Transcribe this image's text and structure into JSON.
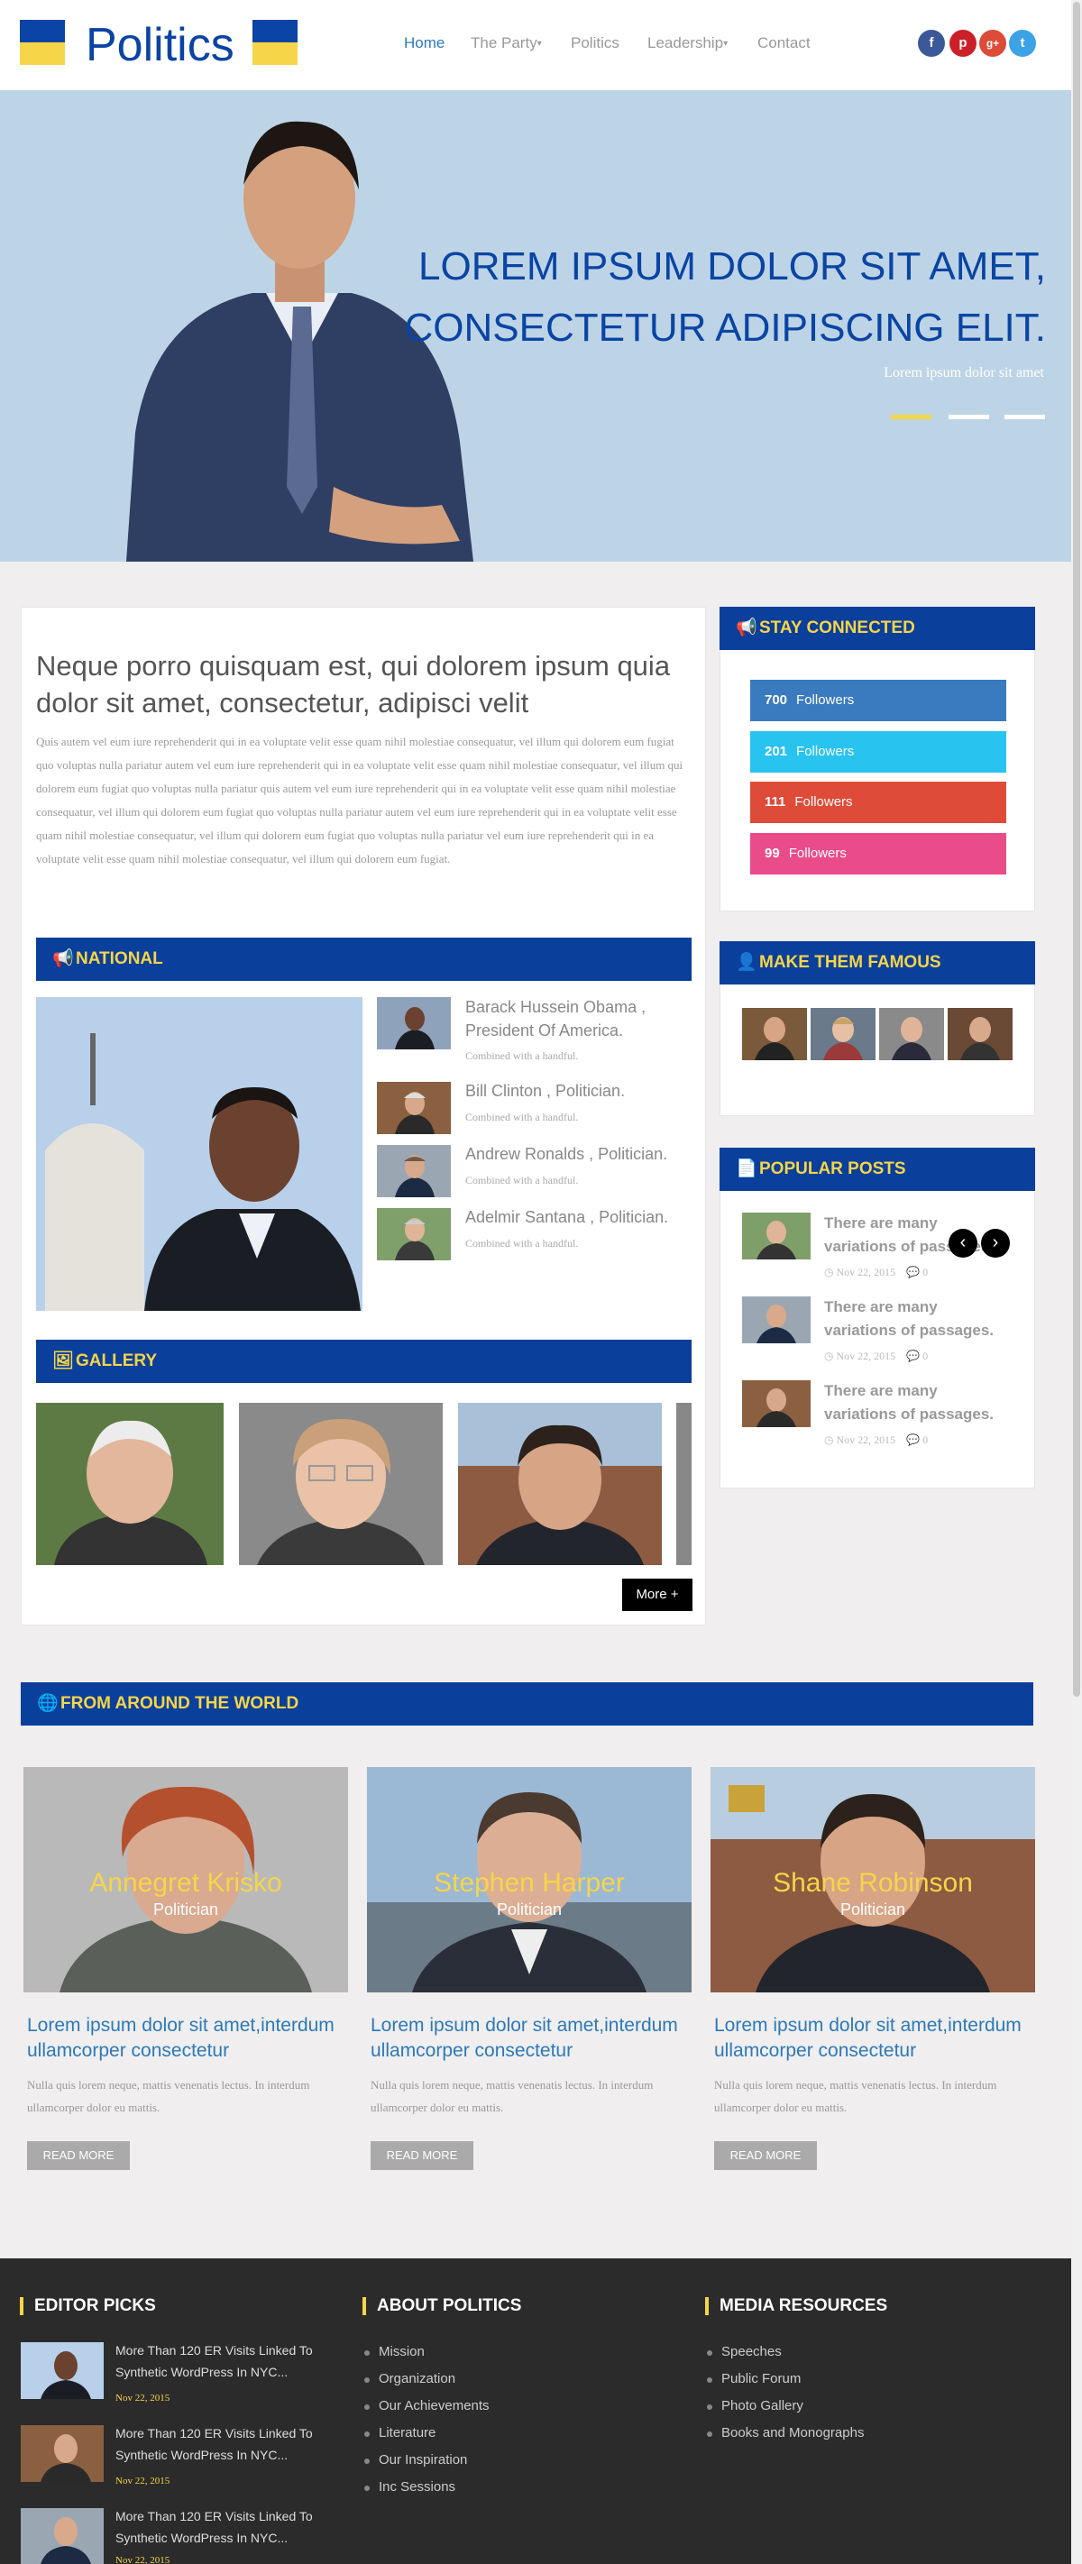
{
  "header": {
    "logo": "Politics",
    "nav": [
      "Home",
      "The Party",
      "Politics",
      "Leadership",
      "Contact"
    ],
    "social": [
      "f",
      "p",
      "g+",
      "t"
    ]
  },
  "hero": {
    "title_line1": "LOREM IPSUM DOLOR SIT AMET,",
    "title_line2": "CONSECTETUR ADIPISCING ELIT.",
    "subtitle": "Lorem ipsum dolor sit amet"
  },
  "intro": {
    "title": "Neque porro quisquam est, qui dolorem ipsum quia dolor sit amet, consectetur, adipisci velit",
    "text": "Quis autem vel eum iure reprehenderit qui in ea voluptate velit esse quam nihil molestiae consequatur, vel illum qui dolorem eum fugiat quo voluptas nulla pariatur autem vel eum iure reprehenderit qui in ea voluptate velit esse quam nihil molestiae consequatur, vel illum qui dolorem eum fugiat quo voluptas nulla pariatur quis autem vel eum iure reprehenderit qui in ea voluptate velit esse quam nihil molestiae consequatur, vel illum qui dolorem eum fugiat quo voluptas nulla pariatur autem vel eum iure reprehenderit qui in ea voluptate velit esse quam nihil molestiae consequatur, vel illum qui dolorem eum fugiat quo voluptas nulla pariatur vel eum iure reprehenderit qui in ea voluptate velit esse quam nihil molestiae consequatur, vel illum qui dolorem eum fugiat."
  },
  "national": {
    "heading": "NATIONAL",
    "items": [
      {
        "title": "Barack Hussein Obama , President Of America.",
        "sub": "Combined with a handful."
      },
      {
        "title": "Bill Clinton , Politician.",
        "sub": "Combined with a handful."
      },
      {
        "title": "Andrew Ronalds , Politician.",
        "sub": "Combined with a handful."
      },
      {
        "title": "Adelmir Santana , Politician.",
        "sub": "Combined with a handful."
      }
    ]
  },
  "gallery": {
    "heading": "GALLERY",
    "more": "More +"
  },
  "stay_connected": {
    "heading": "STAY CONNECTED",
    "rows": [
      {
        "count": "700",
        "label": "Followers",
        "color": "#3a7bbf"
      },
      {
        "count": "201",
        "label": "Followers",
        "color": "#29c3f0"
      },
      {
        "count": "111",
        "label": "Followers",
        "color": "#de4b39"
      },
      {
        "count": "99",
        "label": "Followers",
        "color": "#ea4c89"
      }
    ]
  },
  "famous": {
    "heading": "MAKE THEM FAMOUS"
  },
  "popular": {
    "heading": "POPULAR POSTS",
    "posts": [
      {
        "title": "There are many variations of passages.",
        "date": "Nov 22, 2015",
        "comments": "0"
      },
      {
        "title": "There are many variations of passages.",
        "date": "Nov 22, 2015",
        "comments": "0"
      },
      {
        "title": "There are many variations of passages.",
        "date": "Nov 22, 2015",
        "comments": "0"
      }
    ]
  },
  "world": {
    "heading": "FROM AROUND THE WORLD",
    "cards": [
      {
        "name": "Annegret Krisko",
        "role": "Politician",
        "title": "Lorem ipsum dolor sit amet,interdum ullamcorper consectetur",
        "text": "Nulla quis lorem neque, mattis venenatis lectus. In interdum ullamcorper dolor eu mattis.",
        "button": "READ MORE"
      },
      {
        "name": "Stephen Harper",
        "role": "Politician",
        "title": "Lorem ipsum dolor sit amet,interdum ullamcorper consectetur",
        "text": "Nulla quis lorem neque, mattis venenatis lectus. In interdum ullamcorper dolor eu mattis.",
        "button": "READ MORE"
      },
      {
        "name": "Shane Robinson",
        "role": "Politician",
        "title": "Lorem ipsum dolor sit amet,interdum ullamcorper consectetur",
        "text": "Nulla quis lorem neque, mattis venenatis lectus. In interdum ullamcorper dolor eu mattis.",
        "button": "READ MORE"
      }
    ]
  },
  "footer": {
    "editor_heading": "EDITOR PICKS",
    "about_heading": "ABOUT POLITICS",
    "media_heading": "MEDIA RESOURCES",
    "picks": [
      {
        "title": "More Than 120 ER Visits Linked To Synthetic WordPress In NYC...",
        "date": "Nov 22, 2015"
      },
      {
        "title": "More Than 120 ER Visits Linked To Synthetic WordPress In NYC...",
        "date": "Nov 22, 2015"
      },
      {
        "title": "More Than 120 ER Visits Linked To Synthetic WordPress In NYC...",
        "date": "Nov 22, 2015"
      }
    ],
    "about_links": [
      "Mission",
      "Organization",
      "Our Achievements",
      "Literature",
      "Our Inspiration",
      "Inc Sessions"
    ],
    "media_links": [
      "Speeches",
      "Public Forum",
      "Photo Gallery",
      "Books and Monographs"
    ]
  }
}
